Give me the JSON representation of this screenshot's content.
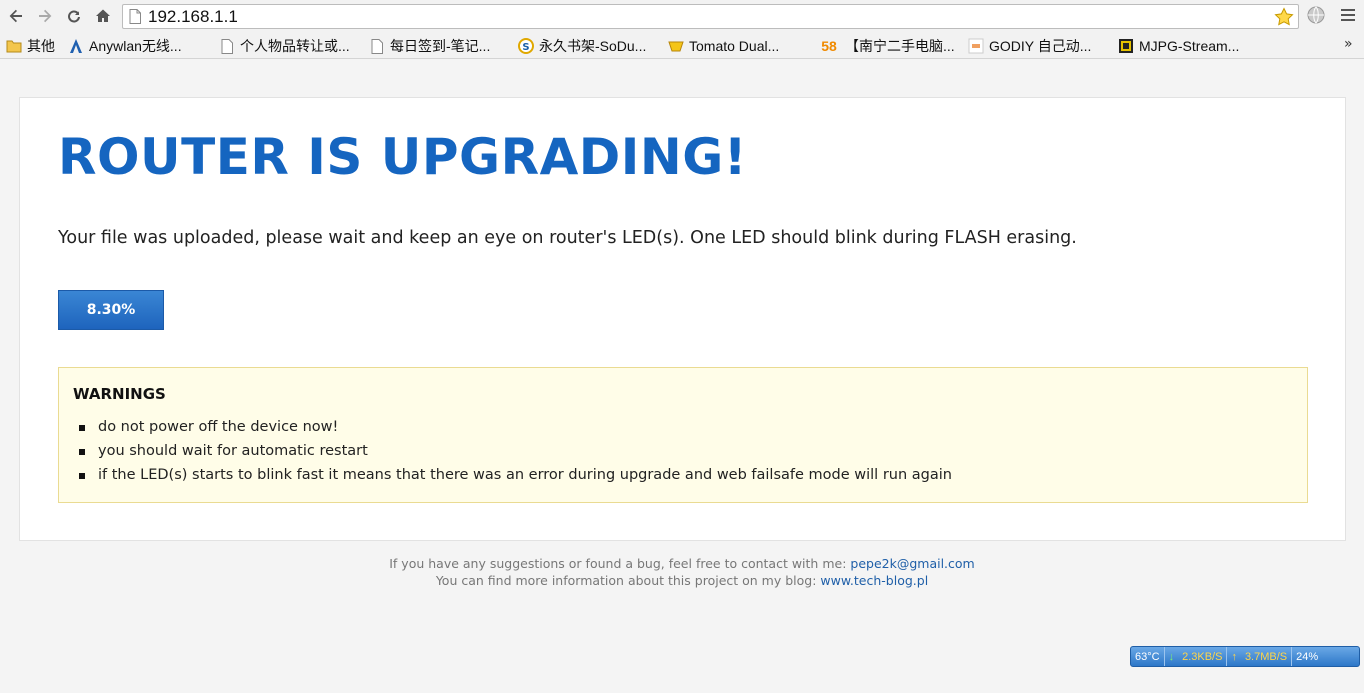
{
  "browser": {
    "url": "192.168.1.1",
    "bookmarks": [
      {
        "label": "其他",
        "icon": "folder-icon"
      },
      {
        "label": "Anywlan无线...",
        "icon": "anywlan-icon"
      },
      {
        "label": "个人物品转让或...",
        "icon": "page-icon"
      },
      {
        "label": "每日签到-笔记...",
        "icon": "page-icon"
      },
      {
        "label": "永久书架-SoDu...",
        "icon": "sodu-icon"
      },
      {
        "label": "Tomato Dual...",
        "icon": "tomato-icon"
      },
      {
        "label": "【南宁二手电脑...",
        "icon": "58-icon",
        "badge": "58"
      },
      {
        "label": "GODIY 自己动...",
        "icon": "godiy-icon"
      },
      {
        "label": "MJPG-Stream...",
        "icon": "mjpg-icon"
      }
    ],
    "more_label": "»"
  },
  "page": {
    "title": "ROUTER IS UPGRADING!",
    "message": "Your file was uploaded, please wait and keep an eye on router's LED(s). One LED should blink during FLASH erasing.",
    "progress": {
      "label": "8.30%",
      "value": 8.3
    },
    "warnings": {
      "title": "WARNINGS",
      "items": [
        "do not power off the device now!",
        "you should wait for automatic restart",
        "if the LED(s) starts to blink fast it means that there was an error during upgrade and web failsafe mode will run again"
      ]
    },
    "footer": {
      "line1_prefix": "If you have any suggestions or found a bug, feel free to contact with me: ",
      "line1_link": "pepe2k@gmail.com",
      "line2_prefix": "You can find more information about this project on my blog: ",
      "line2_link": "www.tech-blog.pl"
    }
  },
  "tray": {
    "temp": "63°C",
    "down": "2.3KB/S",
    "up": "3.7MB/S",
    "cpu": "24%"
  }
}
